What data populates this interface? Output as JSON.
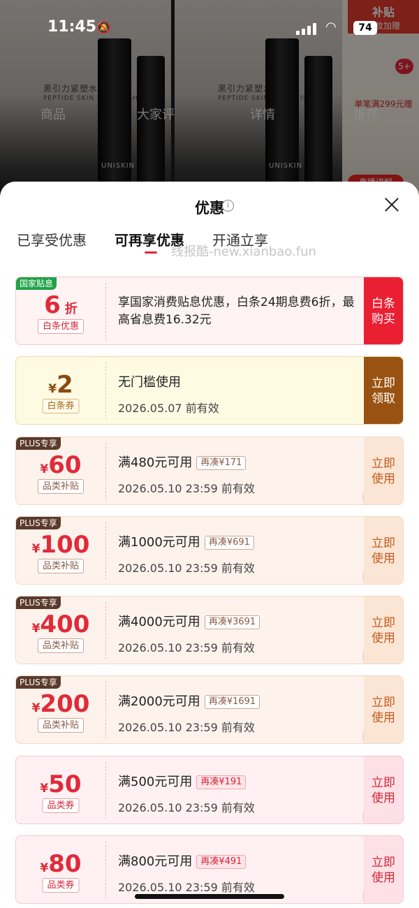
{
  "status_bar": {
    "time": "11:45",
    "battery": "74"
  },
  "background": {
    "product_text": "黑引力紧塑水乳礼",
    "product_text_sub": "PEPTIDE SKIN REPLENISHING",
    "brand": "UNISKIN",
    "tabs": [
      "商品",
      "大家评",
      "详情",
      "推荐"
    ],
    "badge": "5+",
    "promo_head": "补贴",
    "promo_sub": "美妆加赠",
    "promo_line": "单笔满299元赠",
    "live_label": "直播讲解"
  },
  "sheet": {
    "title": "优惠",
    "tabs": [
      {
        "label": "已享受优惠",
        "active": false
      },
      {
        "label": "可再享优惠",
        "active": true
      },
      {
        "label": "开通立享",
        "active": false
      }
    ],
    "watermark": "线报酷-new.xianbao.fun"
  },
  "coupons": [
    {
      "style": "red",
      "corner": "国家贴息",
      "corner_style": "green",
      "currency": "",
      "amount": "6",
      "unit": "折",
      "tag": "白条优惠",
      "desc": "享国家消费贴息优惠，白条24期息费6折，最高省息费16.32元",
      "action": "白条购买"
    },
    {
      "style": "yellow",
      "corner": "",
      "currency": "¥",
      "amount": "2",
      "tag": "白条券",
      "line1": "无门槛使用",
      "line2": "2026.05.07 前有效",
      "action": "立即领取"
    },
    {
      "style": "plus",
      "corner": "PLUS专享",
      "currency": "¥",
      "amount": "60",
      "tag": "品类补贴",
      "line1": "满480元可用",
      "pill": "再凑¥171",
      "line2": "2026.05.10 23:59 前有效",
      "action": "立即使用",
      "stamp": "已领"
    },
    {
      "style": "plus",
      "corner": "PLUS专享",
      "currency": "¥",
      "amount": "100",
      "tag": "品类补贴",
      "line1": "满1000元可用",
      "pill": "再凑¥691",
      "line2": "2026.05.10 23:59 前有效",
      "action": "立即使用",
      "stamp": "已领"
    },
    {
      "style": "plus",
      "corner": "PLUS专享",
      "currency": "¥",
      "amount": "400",
      "tag": "品类补贴",
      "line1": "满4000元可用",
      "pill": "再凑¥3691",
      "line2": "2026.05.10 23:59 前有效",
      "action": "立即使用",
      "stamp": "已领"
    },
    {
      "style": "plus",
      "corner": "PLUS专享",
      "currency": "¥",
      "amount": "200",
      "tag": "品类补贴",
      "line1": "满2000元可用",
      "pill": "再凑¥1691",
      "line2": "2026.05.10 23:59 前有效",
      "action": "立即使用",
      "stamp": "已领"
    },
    {
      "style": "pink",
      "corner": "",
      "currency": "¥",
      "amount": "50",
      "tag": "品类券",
      "line1": "满500元可用",
      "pill": "再凑¥191",
      "line2": "2026.05.10 23:59 前有效",
      "action": "立即使用",
      "stamp": "已领"
    },
    {
      "style": "pink",
      "corner": "",
      "currency": "¥",
      "amount": "80",
      "tag": "品类券",
      "line1": "满800元可用",
      "pill": "再凑¥491",
      "line2": "2026.05.10 23:59 前有效",
      "action": "立即使用",
      "stamp": "已领"
    }
  ]
}
